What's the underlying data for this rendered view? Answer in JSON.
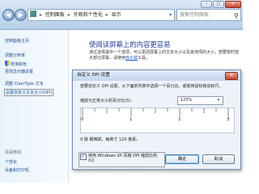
{
  "window": {
    "minimize": "–",
    "maximize": "□",
    "close": "✕"
  },
  "nav": {
    "back": "◀",
    "forward": "▶"
  },
  "address": {
    "icon": "control-panel-icon",
    "crumbs": [
      "控制面板",
      "外观和个性化",
      "显示"
    ],
    "separator": "▸",
    "dropdown": "▾"
  },
  "search": {
    "placeholder": "搜索控制面板",
    "icon": "search-icon"
  },
  "sidebar": {
    "items": [
      "控制面板主页",
      "调整分辨率",
      "校准颜色",
      "更改显示器设置",
      "调整 ClearType 文本",
      "设置自定义文本大小(DPI)"
    ],
    "see_also_heading": "另请参阅",
    "see_also": [
      "个性化",
      "设备和打印机"
    ]
  },
  "main": {
    "title": "使阅读屏幕上的内容更容易",
    "body_before_link": "通过选择其中一个选项，可以更改屏幕上的文本大小以及其他项的大小。若要暂时放大部分屏幕，请使用",
    "link": "放大镜",
    "body_after_link": "工具。"
  },
  "dialog": {
    "title": "自定义 DPI 设置",
    "close": "✕",
    "description": "若要自定义 DPI 设置，从下面的列表中选择一个百分比，或者用鼠标拖动标尺。",
    "scale_label": "缩放为正常大小的百分比(S):",
    "scale_value": "125%",
    "scale_dropdown": "▾",
    "ruler_numbers": [
      "0",
      "1",
      "2",
      "3"
    ],
    "sample_text": "9 磅 细微赋，每英寸 120 像素。",
    "checkbox_checked": "✓",
    "checkbox_label": "使用 Windows XP 风格 DPI 缩放比例(U)",
    "ok": "确定",
    "cancel": "取消"
  }
}
